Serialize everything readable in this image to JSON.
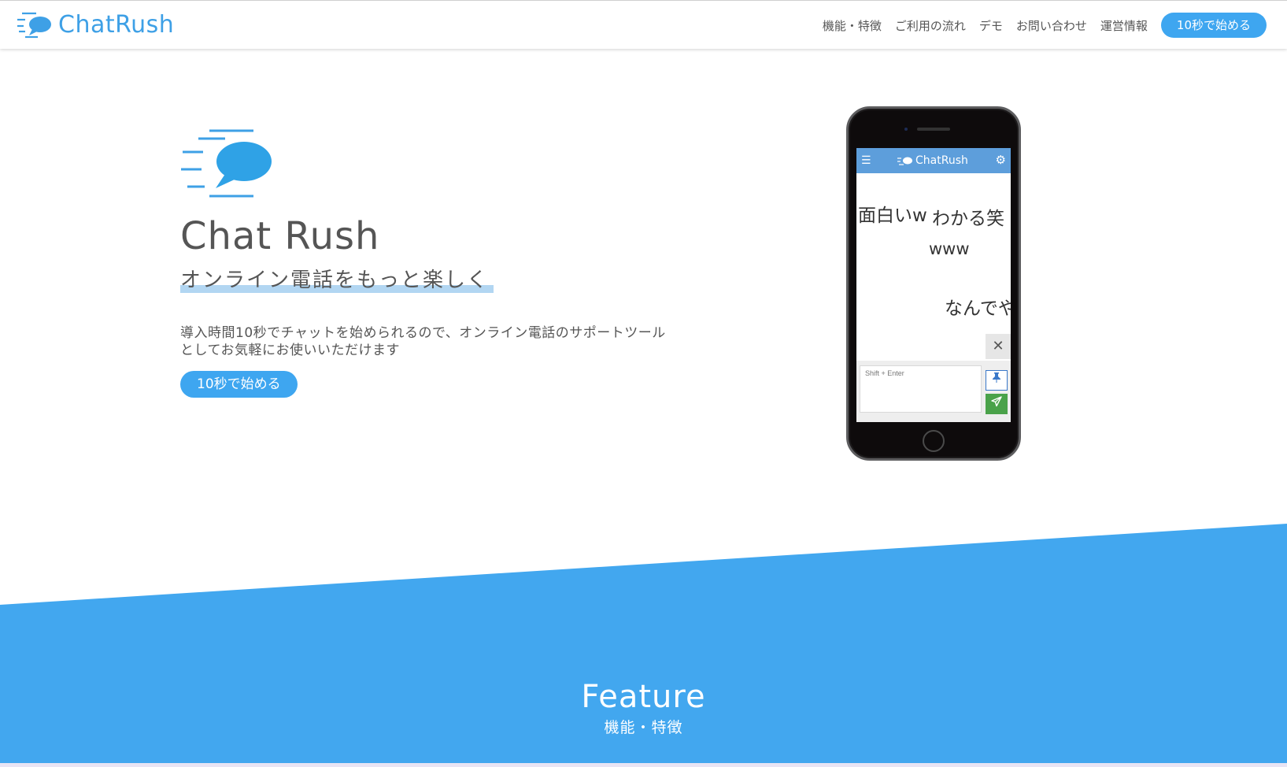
{
  "header": {
    "brand": "ChatRush",
    "nav": [
      "機能・特徴",
      "ご利用の流れ",
      "デモ",
      "お問い合わせ",
      "運営情報"
    ],
    "cta": "10秒で始める"
  },
  "hero": {
    "title": "Chat Rush",
    "subtitle": "オンライン電話をもっと楽しく",
    "description_line1": "導入時間10秒でチャットを始められるので、オンライン電話のサポートツール",
    "description_line2": "としてお気軽にお使いいただけます",
    "cta": "10秒で始める"
  },
  "phone": {
    "app_title": "ChatRush",
    "messages": [
      "面白いw",
      "わかる笑",
      "www",
      "なんでや"
    ],
    "input_placeholder": "Shift + Enter",
    "close_symbol": "✕"
  },
  "feature": {
    "title": "Feature",
    "subtitle": "機能・特徴"
  },
  "colors": {
    "brand_blue": "#3ea6f0",
    "section_blue": "#42a7ef",
    "app_bar": "#5d9edb",
    "send_green": "#4aa24a"
  },
  "icons": [
    "chat-bubble-logo-icon",
    "hamburger-menu-icon",
    "gear-icon",
    "close-icon",
    "pin-icon",
    "send-icon"
  ]
}
